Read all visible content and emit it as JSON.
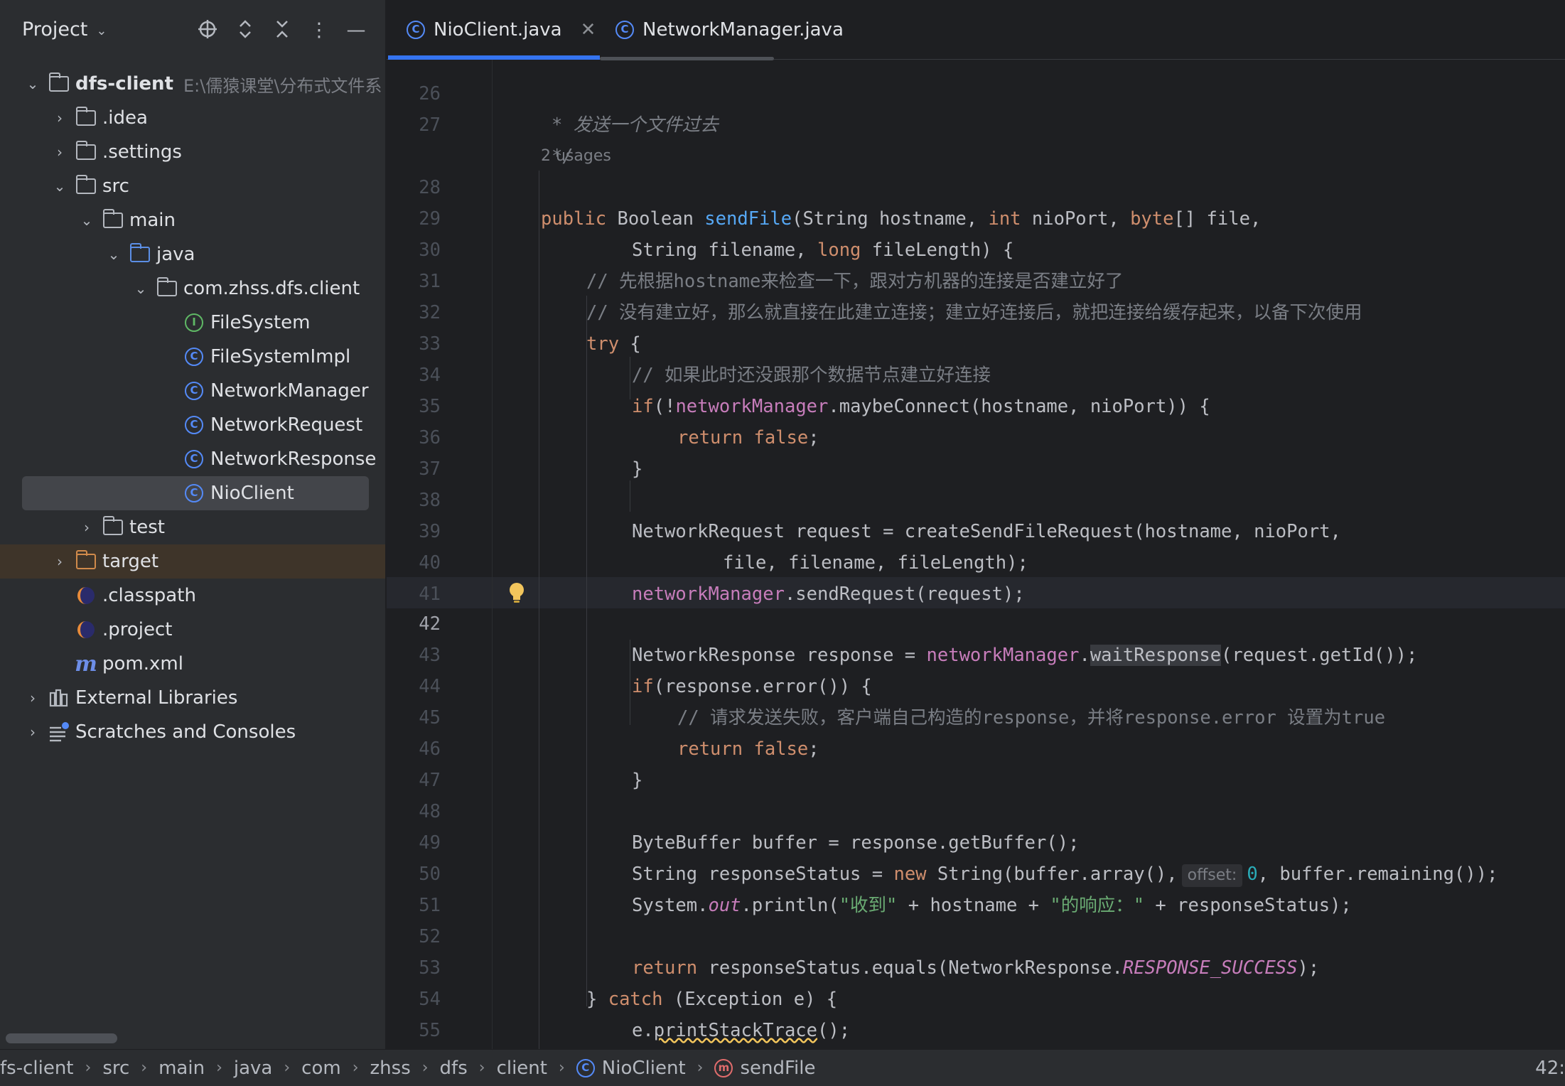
{
  "project_panel": {
    "title": "Project",
    "tree": [
      {
        "label": "dfs-client",
        "path": "E:\\儒猿课堂\\分布式文件系"
      },
      {
        "label": ".idea"
      },
      {
        "label": ".settings"
      },
      {
        "label": "src"
      },
      {
        "label": "main"
      },
      {
        "label": "java"
      },
      {
        "label": "com.zhss.dfs.client"
      },
      {
        "label": "FileSystem"
      },
      {
        "label": "FileSystemImpl"
      },
      {
        "label": "NetworkManager"
      },
      {
        "label": "NetworkRequest"
      },
      {
        "label": "NetworkResponse"
      },
      {
        "label": "NioClient"
      },
      {
        "label": "test"
      },
      {
        "label": "target"
      },
      {
        "label": ".classpath"
      },
      {
        "label": ".project"
      },
      {
        "label": "pom.xml"
      },
      {
        "label": "External Libraries"
      },
      {
        "label": "Scratches and Consoles"
      }
    ]
  },
  "tabs": [
    {
      "label": "NioClient.java",
      "active": true
    },
    {
      "label": "NetworkManager.java",
      "active": false
    }
  ],
  "editor": {
    "usages": "2 usages",
    "current_line": 42,
    "line_numbers": [
      "26",
      "27",
      "28",
      "29",
      "30",
      "31",
      "32",
      "33",
      "34",
      "35",
      "36",
      "37",
      "38",
      "39",
      "40",
      "41",
      "42",
      "43",
      "44",
      "45",
      "46",
      "47",
      "48",
      "49",
      "50",
      "51",
      "52",
      "53",
      "54",
      "55",
      "56"
    ],
    "code": {
      "l26": "* 发送一个文件过去",
      "l27": "*/",
      "l28_a": "public ",
      "l28_b": "Boolean ",
      "l28_c": "sendFile",
      "l28_d": "(String hostname, ",
      "l28_e": "int ",
      "l28_f": "nioPort, ",
      "l28_g": "byte",
      "l28_h": "[] file,",
      "l29_a": "String filename, ",
      "l29_b": "long ",
      "l29_c": "fileLength) {",
      "l30": "// 先根据hostname来检查一下，跟对方机器的连接是否建立好了",
      "l31": "// 没有建立好，那么就直接在此建立连接；建立好连接后，就把连接给缓存起来，以备下次使用",
      "l32_a": "try ",
      "l32_b": "{",
      "l33": "// 如果此时还没跟那个数据节点建立好连接",
      "l34_a": "if",
      "l34_b": "(!",
      "l34_c": "networkManager",
      "l34_d": ".maybeConnect(hostname, nioPort)) {",
      "l35": "return false",
      "l35_b": ";",
      "l36": "}",
      "l38": "NetworkRequest request = createSendFileRequest(hostname, nioPort,",
      "l39": "file, filename, fileLength);",
      "l40_a": "networkManager",
      "l40_b": ".sendRequest(request);",
      "l42_a": "NetworkResponse response = ",
      "l42_b": "networkManager",
      "l42_c": ".",
      "l42_d": "waitResponse",
      "l42_e": "(request.getId());",
      "l43_a": "if",
      "l43_b": "(response.error()) {",
      "l44": "// 请求发送失败，客户端自己构造的response，并将response.error 设置为true",
      "l45": "return false",
      "l45_b": ";",
      "l46": "}",
      "l48": "ByteBuffer buffer = response.getBuffer();",
      "l49_a": "String responseStatus = ",
      "l49_b": "new ",
      "l49_c": "String(buffer.array(),",
      "l49_hint": "offset:",
      "l49_d": "0",
      "l49_e": ", buffer.remaining());",
      "l50_a": "System.",
      "l50_b": "out",
      "l50_c": ".println(",
      "l50_d": "\"收到\"",
      "l50_e": " + hostname + ",
      "l50_f": "\"的响应：\"",
      "l50_g": " + responseStatus);",
      "l52_a": "return ",
      "l52_b": "responseStatus.equals(NetworkResponse.",
      "l52_c": "RESPONSE_SUCCESS",
      "l52_d": ");",
      "l53_a": "} ",
      "l53_b": "catch ",
      "l53_c": "(Exception e) {",
      "l54_a": "e.",
      "l54_b": "printStackTrace",
      "l54_c": "();",
      "l55": "}"
    }
  },
  "statusbar": {
    "crumbs": [
      "fs-client",
      "src",
      "main",
      "java",
      "com",
      "zhss",
      "dfs",
      "client",
      "NioClient",
      "sendFile"
    ],
    "position": "42:"
  },
  "colors": {
    "accent": "#3574f0",
    "keyword": "#cf8e6d",
    "function": "#56a8f5",
    "field": "#c77dbb",
    "comment": "#7a7e85",
    "string": "#6aab73"
  }
}
